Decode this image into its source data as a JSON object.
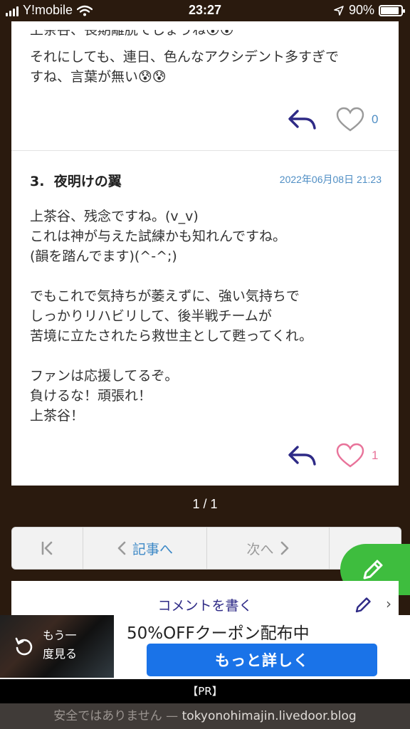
{
  "status_bar": {
    "carrier": "Y!mobile",
    "time": "23:27",
    "battery": "90%",
    "battery_level": 0.9
  },
  "previous_comment": {
    "cut_text": "上茶谷、長期離脱でしょうね😰😰",
    "text": "それにしても、連日、色んなアクシデント多すぎで\nすね、言葉が無い😰😰",
    "likes": "0",
    "heart_color": "#9a9a9a"
  },
  "comment": {
    "number": "3.",
    "author": "夜明けの翼",
    "date": "2022年06月08日 21:23",
    "body": "上茶谷、残念ですね。(v_v)\nこれは神が与えた試練かも知れんですね。\n(韻を踏んでます)(^-^;)\n\nでもこれで気持ちが萎えずに、強い気持ちで\nしっかりリハビリして、後半戦チームが\n苦境に立たされたら救世主として甦ってくれ。\n\nファンは応援してるぞ。\n負けるな！頑張れ！\n上茶谷！",
    "likes": "1",
    "heart_color": "#e8739a"
  },
  "pager": "1 / 1",
  "nav": {
    "first_icon": "first-page-icon",
    "prev_label": "記事へ",
    "next_label": "次へ",
    "accent": "#3c88c6"
  },
  "write_comment": {
    "label": "コメントを書く",
    "fab_color": "#3ebd3e"
  },
  "ad": {
    "replay_label_1": "もう一",
    "replay_label_2": "度見る",
    "headline": "50%OFFクーポン配布中",
    "button_label": "もっと詳しく",
    "button_color": "#1a73e8"
  },
  "pr_label": "【PR】",
  "url_bar": {
    "insecure": "安全ではありません — ",
    "domain": "tokyonohimajin.livedoor.blog"
  }
}
